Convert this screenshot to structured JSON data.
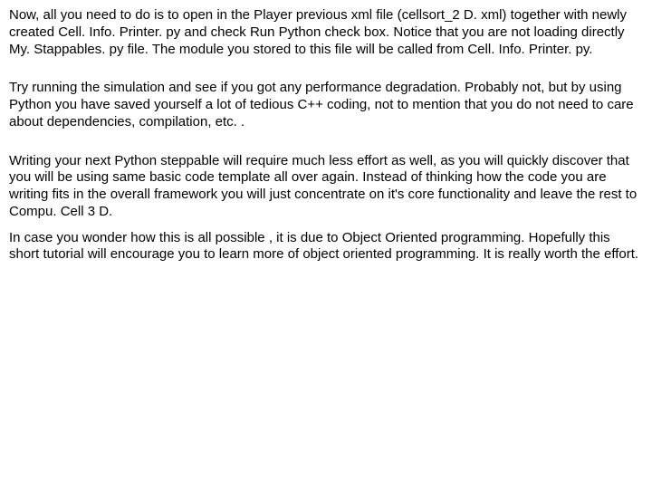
{
  "paragraphs": {
    "p1": "Now, all you need to do is to open in the Player previous xml file (cellsort_2 D. xml) together with newly created Cell. Info. Printer. py and check Run Python check box. Notice that you are not loading directly My. Stappables. py file. The module you stored to this file will be called from Cell. Info. Printer. py.",
    "p2": "Try running the simulation and see if you got any performance degradation. Probably not, but by using Python you have saved yourself a lot of tedious C++ coding, not to mention that you do not need to care about dependencies, compilation, etc. .",
    "p3": "Writing your next Python steppable will require much less effort as well, as you will quickly discover that you will be using same basic code template all over again. Instead of thinking how the code you are writing fits in the overall framework you will just concentrate on it's core functionality and leave the rest to Compu. Cell 3 D.",
    "p4": "In case you wonder how this is all possible , it is due to Object Oriented programming. Hopefully this short tutorial will encourage you to learn more of object oriented programming. It is really worth the effort."
  }
}
